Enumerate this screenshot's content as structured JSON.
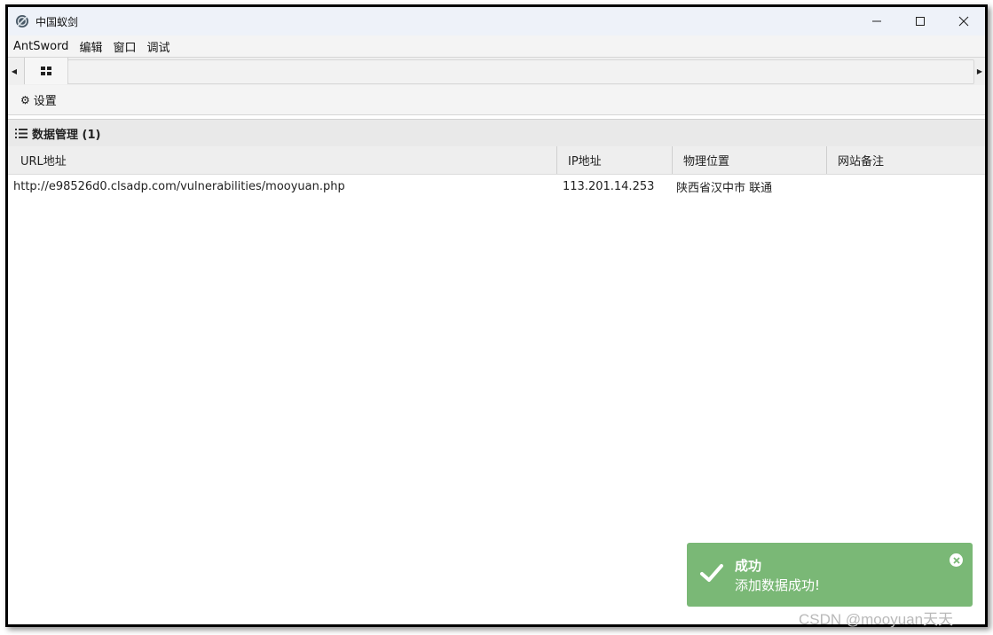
{
  "window": {
    "title": "中国蚁剑",
    "controls": {
      "minimize": "─",
      "maximize": "☐",
      "close": "✕"
    }
  },
  "menubar": {
    "items": [
      "AntSword",
      "编辑",
      "窗口",
      "调试"
    ]
  },
  "tabbar": {
    "scroll_left": "◀",
    "scroll_right": "▶",
    "home_icon": "grid-icon"
  },
  "toolbar": {
    "settings_label": "设置",
    "settings_icon": "⚙"
  },
  "panel": {
    "title": "数据管理 (1)",
    "icon": "list-icon"
  },
  "table": {
    "columns": [
      "URL地址",
      "IP地址",
      "物理位置",
      "网站备注"
    ],
    "rows": [
      {
        "url": "http://e98526d0.clsadp.com/vulnerabilities/mooyuan.php",
        "ip": "113.201.14.253",
        "location": "陕西省汉中市 联通",
        "note": ""
      }
    ]
  },
  "toast": {
    "title": "成功",
    "message": "添加数据成功!",
    "color": "#7ab876",
    "icon": "check-icon"
  },
  "watermark": "CSDN @mooyuan天天"
}
